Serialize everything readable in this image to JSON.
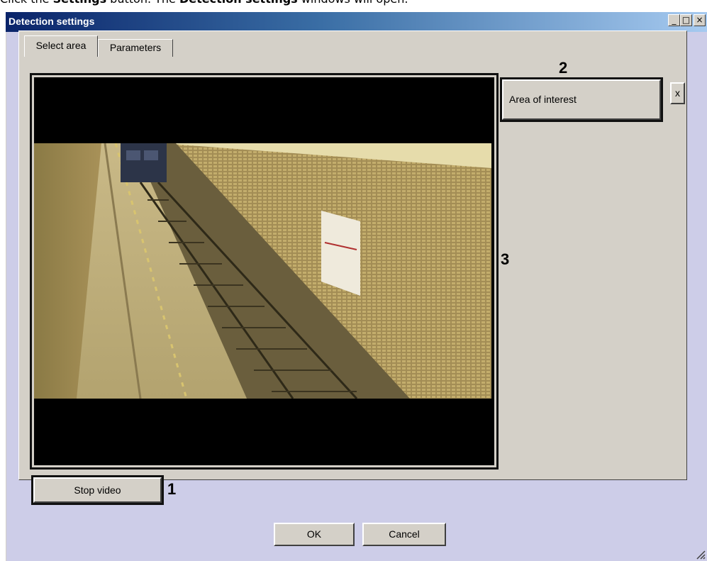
{
  "doc_caption": {
    "prefix": "Click the ",
    "settings_word": "Settings",
    "middle": " button. The ",
    "window_word": "Detection settings",
    "suffix": " windows will open."
  },
  "window": {
    "title": "Detection settings",
    "controls": {
      "minimize": "_",
      "maximize": "□",
      "close": "×"
    }
  },
  "tabs": [
    {
      "label": "Select area",
      "active": true
    },
    {
      "label": "Parameters",
      "active": false
    }
  ],
  "video": {
    "description_icon": "camera-feed-subway-platform",
    "stop_button": "Stop video"
  },
  "area_panel": {
    "area_button": "Area of interest",
    "remove_button": "x"
  },
  "dialog_buttons": {
    "ok": "OK",
    "cancel": "Cancel"
  },
  "callouts": {
    "one": "1",
    "two": "2",
    "three": "3"
  },
  "colors": {
    "window_bg": "#d4d0c8",
    "titlebar_start": "#0a246a",
    "titlebar_end": "#a6caf0",
    "client_bg": "#cdcde8",
    "highlight": "#111111"
  }
}
